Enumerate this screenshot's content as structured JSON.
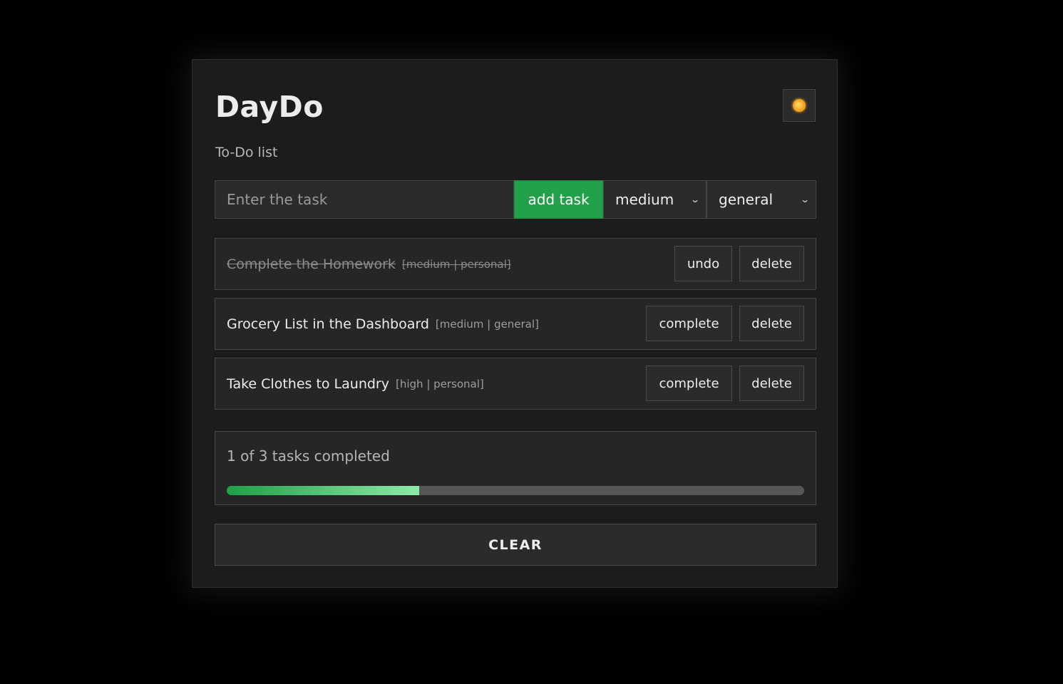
{
  "app": {
    "title": "DayDo",
    "subtitle": "To-Do list",
    "theme_icon": "sun-icon"
  },
  "form": {
    "placeholder": "Enter the task",
    "value": "",
    "add_label": "add task",
    "priority_selected": "medium",
    "category_selected": "general"
  },
  "tasks": [
    {
      "text": "Complete the Homework",
      "meta": "[medium | personal]",
      "completed": true,
      "action_label": "undo",
      "delete_label": "delete"
    },
    {
      "text": "Grocery List in the Dashboard",
      "meta": "[medium | general]",
      "completed": false,
      "action_label": "complete",
      "delete_label": "delete"
    },
    {
      "text": "Take Clothes to Laundry",
      "meta": "[high | personal]",
      "completed": false,
      "action_label": "complete",
      "delete_label": "delete"
    }
  ],
  "progress": {
    "text": "1 of 3 tasks completed",
    "completed": 1,
    "total": 3
  },
  "clear_label": "CLEAR",
  "colors": {
    "accent_green": "#22a04a",
    "background": "#000000",
    "card": "#1c1c1c"
  }
}
